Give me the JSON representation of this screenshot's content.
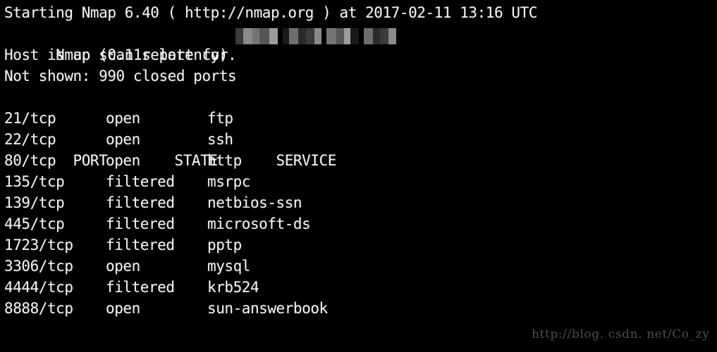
{
  "terminal": {
    "background_color": "#000000",
    "text_color": "#f2f2f2",
    "header_lines": [
      "Starting Nmap 6.40 ( http://nmap.org ) at 2017-02-11 13:16 UTC",
      "Nmap scan report for ",
      "Host is up (0.11s latency).",
      "Not shown: 990 closed ports"
    ],
    "redaction": {
      "name": "redacted-hostname",
      "style": "pixelated-mosaic",
      "block_colors": [
        "#1a1a1a",
        "#3b3b3b",
        "#565656",
        "#6e6e6e",
        "#8a8a8a",
        "#9c9c9c",
        "#2a2a2a",
        "#747474"
      ]
    },
    "table": {
      "headers": {
        "port": "PORT",
        "state": "STATE",
        "service": "SERVICE"
      },
      "rows": [
        {
          "port": "21/tcp",
          "state": "open",
          "service": "ftp"
        },
        {
          "port": "22/tcp",
          "state": "open",
          "service": "ssh"
        },
        {
          "port": "80/tcp",
          "state": "open",
          "service": "http"
        },
        {
          "port": "135/tcp",
          "state": "filtered",
          "service": "msrpc"
        },
        {
          "port": "139/tcp",
          "state": "filtered",
          "service": "netbios-ssn"
        },
        {
          "port": "445/tcp",
          "state": "filtered",
          "service": "microsoft-ds"
        },
        {
          "port": "1723/tcp",
          "state": "filtered",
          "service": "pptp"
        },
        {
          "port": "3306/tcp",
          "state": "open",
          "service": "mysql"
        },
        {
          "port": "4444/tcp",
          "state": "filtered",
          "service": "krb524"
        },
        {
          "port": "8888/tcp",
          "state": "open",
          "service": "sun-answerbook"
        }
      ]
    }
  },
  "watermark": {
    "text": "http://blog. csdn. net/Co_zy",
    "color": "#4e4e4e"
  }
}
